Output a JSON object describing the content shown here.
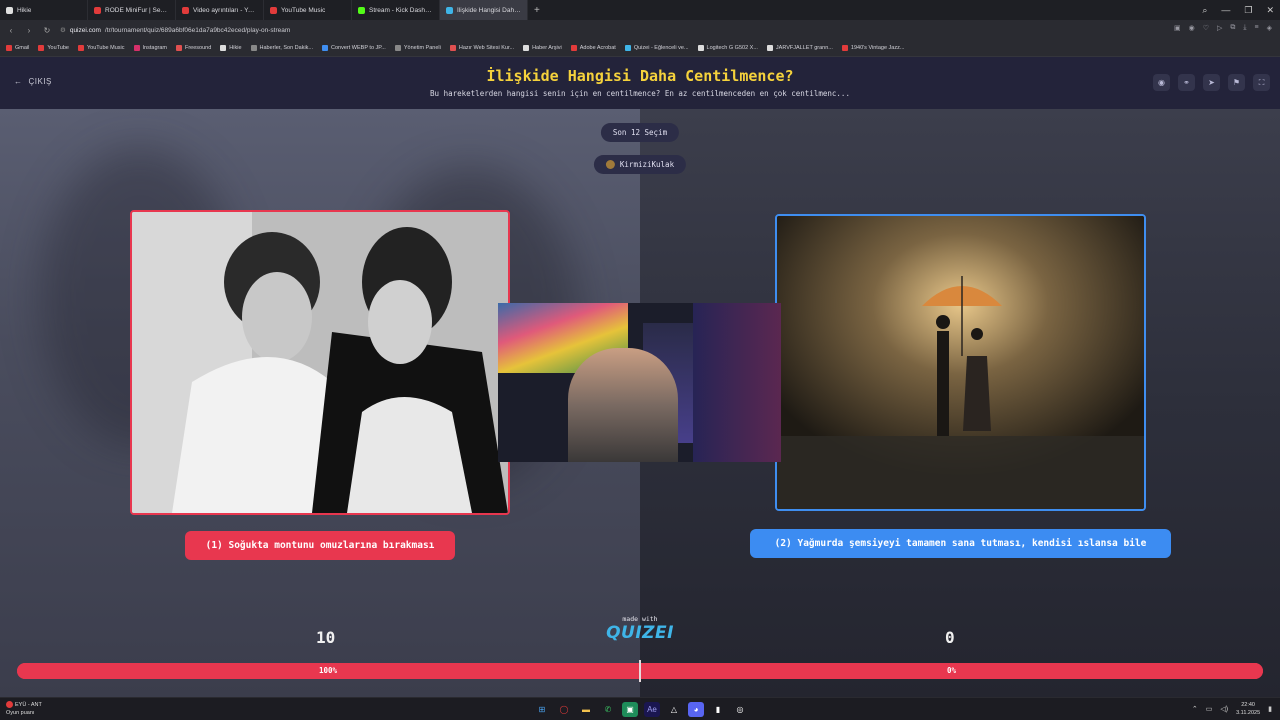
{
  "browser": {
    "tabs": [
      {
        "label": "Hikie",
        "color": "#e0e0e0"
      },
      {
        "label": "RODE MiniFur | Sesçi Baba",
        "color": "#e23b3b"
      },
      {
        "label": "Video ayrıntıları - YouTube",
        "color": "#e23b3b"
      },
      {
        "label": "YouTube Music",
        "color": "#e23b3b"
      },
      {
        "label": "Stream - Kick Dashboard",
        "color": "#53fc18"
      },
      {
        "label": "İlişkide Hangisi Daha Cen...",
        "color": "#3fb5e8"
      }
    ],
    "new_tab": "+",
    "url_host": "quizei.com",
    "url_path": "/tr/tournament/quiz/689a6bf06e1da7a9bc42eced/play-on-stream",
    "bookmarks": [
      {
        "label": "Gmail",
        "color": "#e23b3b"
      },
      {
        "label": "YouTube",
        "color": "#e23b3b"
      },
      {
        "label": "YouTube Music",
        "color": "#e23b3b"
      },
      {
        "label": "Instagram",
        "color": "#d6306a"
      },
      {
        "label": "Freesound",
        "color": "#e05050"
      },
      {
        "label": "Hikie",
        "color": "#ddd"
      },
      {
        "label": "Haberler, Son Dakik...",
        "color": "#888"
      },
      {
        "label": "Convert WEBP to JP...",
        "color": "#3f8ef0"
      },
      {
        "label": "Yönetim Paneli",
        "color": "#888"
      },
      {
        "label": "Hazır Web Sitesi Kur...",
        "color": "#e05050"
      },
      {
        "label": "Haber Arşivi",
        "color": "#ddd"
      },
      {
        "label": "Adobe Acrobat",
        "color": "#e23b3b"
      },
      {
        "label": "Quizei - Eğlenceli ve...",
        "color": "#3fb5e8"
      },
      {
        "label": "Logitech G G502 X...",
        "color": "#ddd"
      },
      {
        "label": "JARVFJALLET grann...",
        "color": "#ddd"
      },
      {
        "label": "1940's Vintage Jazz...",
        "color": "#e23b3b"
      }
    ]
  },
  "header": {
    "exit_label": "ÇIKIŞ",
    "title": "İlişkide Hangisi Daha Centilmence?",
    "subtitle": "Bu hareketlerden hangisi senin için en centilmence? En az centilmenceden en çok centilmenc..."
  },
  "last_choices": "Son 12 Seçim",
  "streamer_name": "KirmiziKulak",
  "choices": {
    "left": {
      "label": "(1) Soğukta montunu omuzlarına bırakması",
      "score": "10",
      "percent": "100%",
      "border_color": "#e8374f"
    },
    "right": {
      "label": "(2) Yağmurda şemsiyeyi tamamen sana tutması, kendisi ıslansa bile",
      "score": "0",
      "percent": "0%",
      "border_color": "#3c8cf2"
    }
  },
  "progress": {
    "left_fraction": 1.0,
    "right_fraction": 0.0
  },
  "branding": {
    "made_with": "made with",
    "logo": "QUIZEI"
  },
  "taskbar": {
    "weather_line1": "EYÜ - ANT",
    "weather_line2": "Oyun puanı",
    "time": "22:40",
    "date": "3.11.2025"
  }
}
